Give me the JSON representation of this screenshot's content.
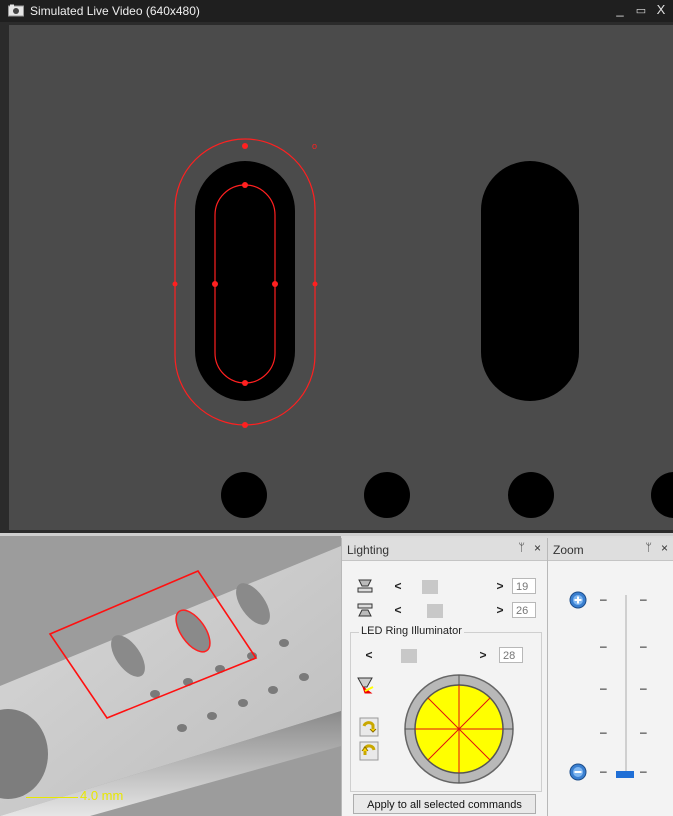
{
  "window": {
    "title": "Simulated Live Video (640x480)",
    "min": "_",
    "max": "▭",
    "close": "X"
  },
  "view3d": {
    "scale_label": "4.0 mm"
  },
  "lighting": {
    "title": "Lighting",
    "pin": "ᛘ",
    "close": "×",
    "slider1": {
      "value": "19",
      "fill": 0.22
    },
    "slider2": {
      "value": "26",
      "fill": 0.28
    },
    "led_group_label": "LED Ring Illuminator",
    "slider3": {
      "value": "28",
      "fill": 0.28
    },
    "apply_button": "Apply to all selected commands",
    "left_arrow": "<",
    "right_arrow": ">"
  },
  "zoom": {
    "title": "Zoom",
    "pin": "ᛘ",
    "close": "×",
    "tick": "–",
    "level": 0.0
  },
  "colors": {
    "overlay_red": "#ff2020",
    "ring_yellow": "#ffff00",
    "scale_yellow": "#e8e800"
  }
}
